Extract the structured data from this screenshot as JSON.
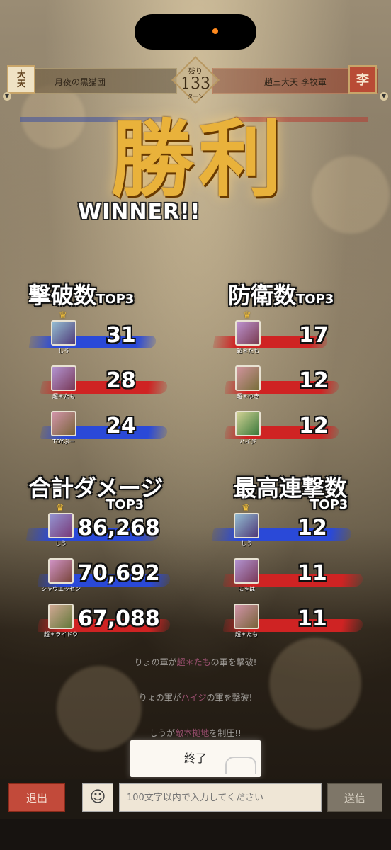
{
  "battle": {
    "left_team": "月夜の黒猫団",
    "left_emblem": "大天",
    "right_team": "趙三大天 李牧軍",
    "right_emblem": "李",
    "timer_label": "残り",
    "timer_value": "133",
    "timer_unit": "ターン"
  },
  "victory": {
    "title": "勝利",
    "subtitle": "WINNER!!"
  },
  "rankings": {
    "kills": {
      "title": "撃破数",
      "suffix": "TOP3",
      "rows": [
        {
          "name": "しう",
          "value": "31",
          "color": "blue"
        },
        {
          "name": "超＊たも",
          "value": "28",
          "color": "red"
        },
        {
          "name": "TOYぶー",
          "value": "24",
          "color": "blue"
        }
      ]
    },
    "defense": {
      "title": "防衛数",
      "suffix": "TOP3",
      "rows": [
        {
          "name": "超＊たも",
          "value": "17",
          "color": "red"
        },
        {
          "name": "超＊ゆき",
          "value": "12",
          "color": "red"
        },
        {
          "name": "ハイジ",
          "value": "12",
          "color": "red"
        }
      ]
    },
    "damage": {
      "title": "合計ダメージ",
      "suffix": "TOP3",
      "rows": [
        {
          "name": "しう",
          "value": "86,268",
          "color": "blue"
        },
        {
          "name": "シャウエッセン",
          "value": "70,692",
          "color": "blue"
        },
        {
          "name": "超＊ライドウ",
          "value": "67,088",
          "color": "red"
        }
      ]
    },
    "combo": {
      "title": "最高連撃数",
      "suffix": "TOP3",
      "rows": [
        {
          "name": "しう",
          "value": "12",
          "color": "blue"
        },
        {
          "name": "にゃは",
          "value": "11",
          "color": "red"
        },
        {
          "name": "超＊たも",
          "value": "11",
          "color": "red"
        }
      ]
    }
  },
  "log": {
    "line1_pre": "りょの軍が",
    "line1_hl": "超＊たも",
    "line1_post": "の軍を撃破!",
    "line2_pre": "りょの軍が",
    "line2_hl": "ハイジ",
    "line2_post": "の軍を撃破!",
    "line3_pre": "しうが",
    "line3_hl": "敵本拠地",
    "line3_post": "を制圧!!"
  },
  "controls": {
    "end_label": "終了",
    "exit_label": "退出",
    "emoji_icon": "☺",
    "chat_placeholder": "100文字以内で入力してください",
    "send_label": "送信"
  },
  "colors": {
    "blue_stroke": "#2a49d8",
    "red_stroke": "#cf2323",
    "gold": "#e9b23b"
  }
}
